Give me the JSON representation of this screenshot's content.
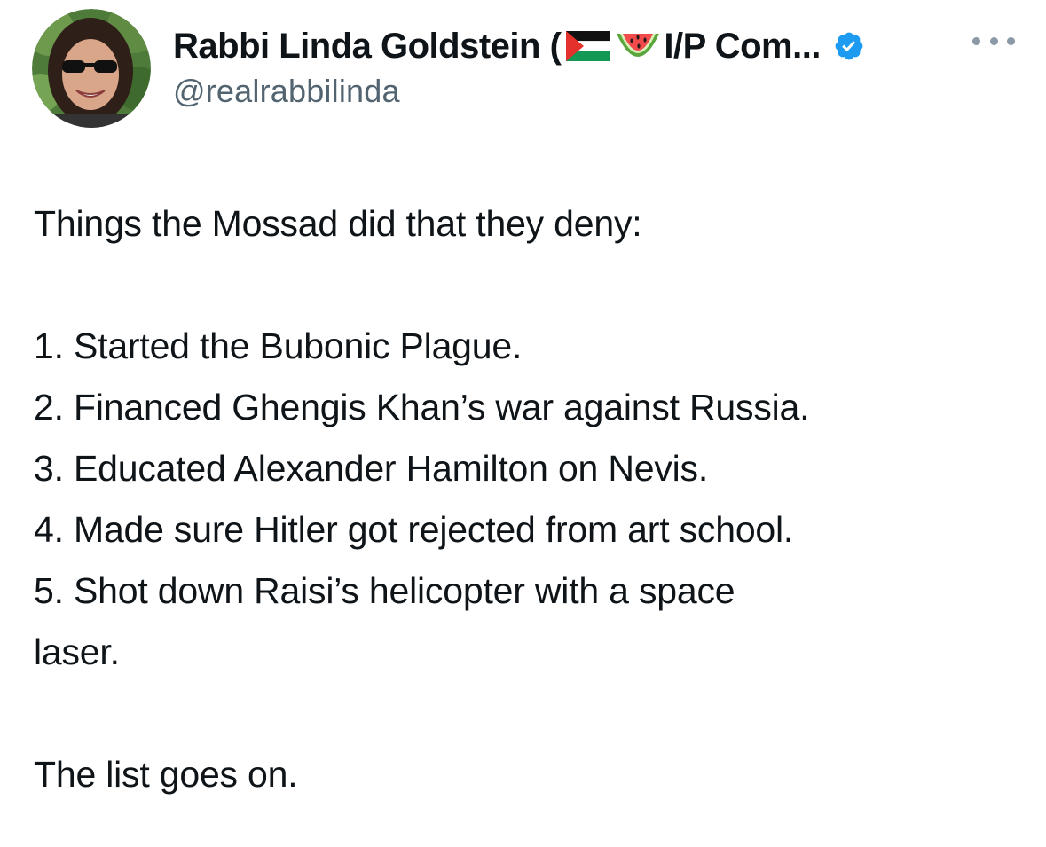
{
  "author": {
    "display_name_start": "Rabbi Linda Goldstein (",
    "display_name_end": "I/P Com...",
    "flag_icon": "palestinian-flag-icon",
    "emoji_icon": "watermelon-icon",
    "verified_icon": "verified-badge-icon",
    "handle": "@realrabbilinda",
    "avatar": "profile-photo"
  },
  "menu": {
    "icon": "more-options-icon"
  },
  "tweet": {
    "intro": "Things the Mossad did that they deny:",
    "items": [
      "1. Started the Bubonic Plague.",
      "2. Financed Ghengis Khan’s war against Russia.",
      "3. Educated Alexander Hamilton on Nevis.",
      "4. Made sure Hitler got rejected from art school.",
      "5. Shot down Raisi’s helicopter with a space",
      "laser."
    ],
    "outro": "The list goes on."
  },
  "colors": {
    "text": "#0f1419",
    "secondary": "#536471",
    "verified": "#1d9bf0",
    "flag_red": "#e4312b",
    "flag_green": "#149954",
    "watermelon_flesh": "#f24b4b",
    "watermelon_rind": "#5aa63c"
  }
}
